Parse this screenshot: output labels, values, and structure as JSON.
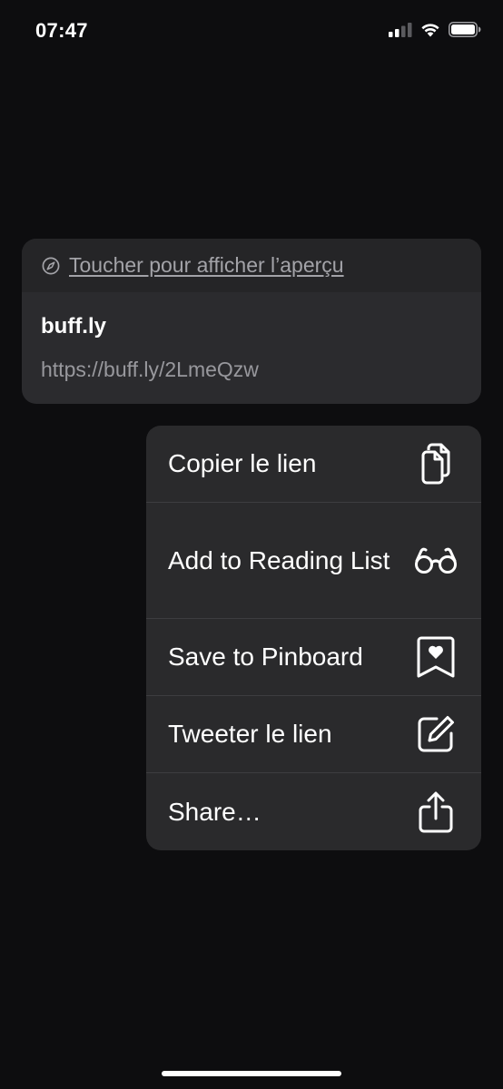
{
  "status_bar": {
    "time": "07:47",
    "icons": [
      "cellular-signal-icon",
      "wifi-icon",
      "battery-icon"
    ]
  },
  "preview": {
    "header_icon": "compass-icon",
    "tap_to_preview": "Toucher pour afficher l’aperçu",
    "title": "buff.ly",
    "url": "https://buff.ly/2LmeQzw"
  },
  "menu": {
    "items": [
      {
        "label": "Copier le lien",
        "icon": "copy-icon"
      },
      {
        "label": "Add to Reading List",
        "icon": "glasses-icon"
      },
      {
        "label": "Save to Pinboard",
        "icon": "bookmark-heart-icon"
      },
      {
        "label": "Tweeter le lien",
        "icon": "compose-icon"
      },
      {
        "label": "Share…",
        "icon": "share-icon"
      }
    ]
  },
  "colors": {
    "background": "#0d0d0f",
    "card": "#2b2b2e",
    "menu": "#2a2a2c",
    "secondary_text": "#98989d"
  }
}
